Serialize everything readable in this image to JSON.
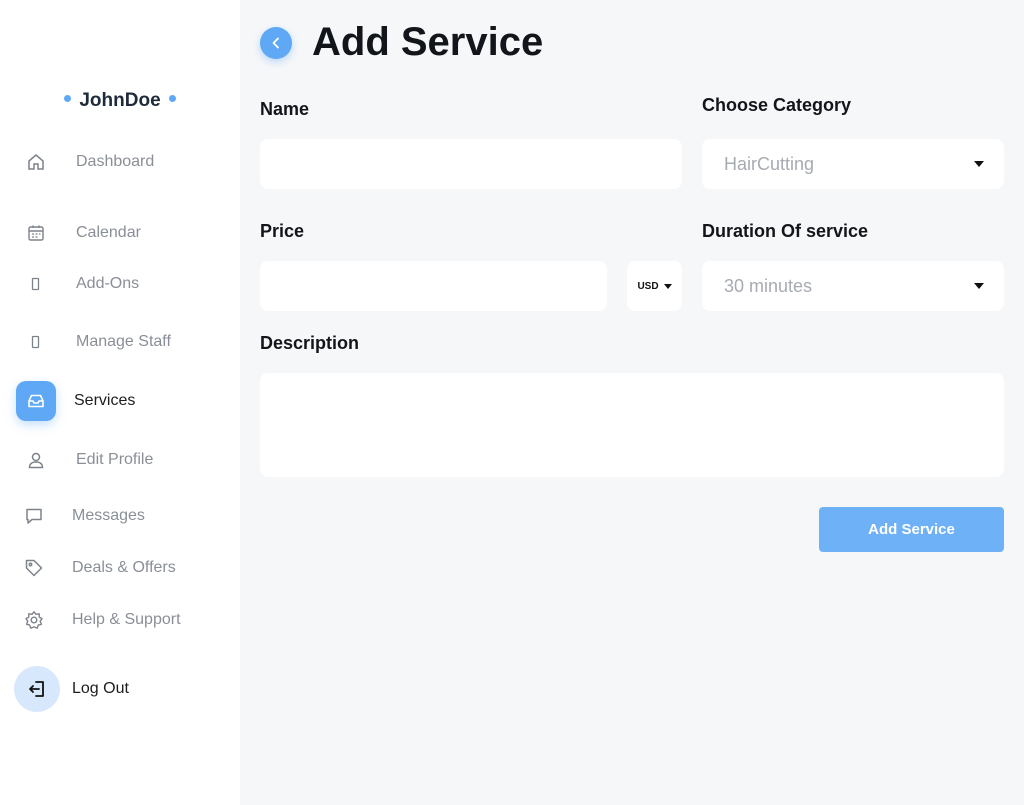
{
  "user": {
    "name": "JohnDoe"
  },
  "nav": [
    {
      "label": "Dashboard",
      "icon": "home-icon"
    },
    {
      "label": "Calendar",
      "icon": "calendar-icon"
    },
    {
      "label": "Add-Ons",
      "icon": "add-ons-icon"
    },
    {
      "label": "Manage Staff",
      "icon": "staff-icon"
    },
    {
      "label": "Services",
      "icon": "inbox-icon",
      "active": true
    },
    {
      "label": "Edit Profile",
      "icon": "user-icon"
    },
    {
      "label": "Messages",
      "icon": "chat-icon"
    },
    {
      "label": "Deals & Offers",
      "icon": "tag-icon"
    },
    {
      "label": "Help & Support",
      "icon": "gear-icon"
    },
    {
      "label": "Log Out",
      "icon": "logout-icon"
    }
  ],
  "page": {
    "title": "Add Service"
  },
  "form": {
    "name_label": "Name",
    "name_value": "",
    "category_label": "Choose Category",
    "category_value": "HairCutting",
    "price_label": "Price",
    "price_value": "",
    "currency_value": "USD",
    "duration_label": "Duration Of service",
    "duration_value": "30 minutes",
    "description_label": "Description",
    "description_value": "",
    "submit_label": "Add Service"
  },
  "colors": {
    "accent": "#5ea8f5",
    "button": "#6eb1f7",
    "background": "#f6f7f9",
    "logout_bg": "#d8e8fc"
  }
}
